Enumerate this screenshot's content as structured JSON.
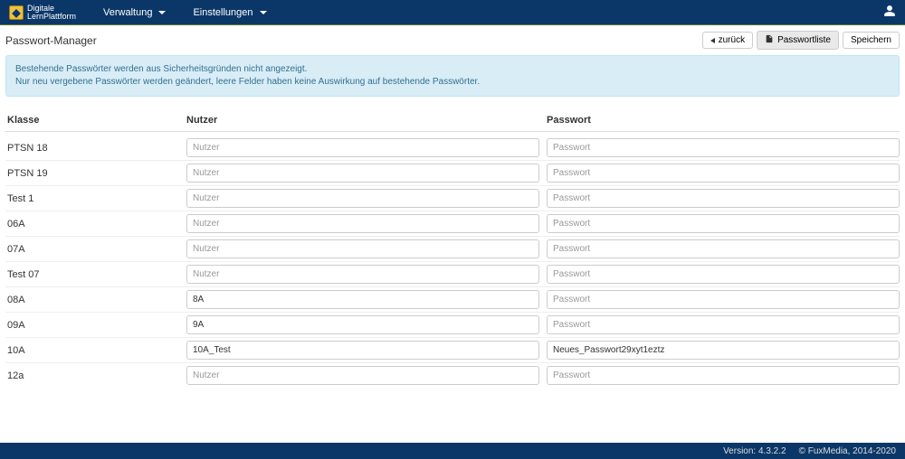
{
  "brand": {
    "line1": "Digitale",
    "line2": "LernPlattform"
  },
  "nav": {
    "verwaltung": "Verwaltung",
    "einstellungen": "Einstellungen"
  },
  "page": {
    "title": "Passwort-Manager",
    "btn_back": "zurück",
    "btn_list": "Passwortliste",
    "btn_save": "Speichern"
  },
  "alert": {
    "line1": "Bestehende Passwörter werden aus Sicherheitsgründen nicht angezeigt.",
    "line2": "Nur neu vergebene Passwörter werden geändert, leere Felder haben keine Auswirkung auf bestehende Passwörter."
  },
  "headers": {
    "klasse": "Klasse",
    "nutzer": "Nutzer",
    "passwort": "Passwort"
  },
  "placeholders": {
    "nutzer": "Nutzer",
    "passwort": "Passwort"
  },
  "rows": [
    {
      "klasse": "PTSN 18",
      "nutzer": "",
      "passwort": ""
    },
    {
      "klasse": "PTSN 19",
      "nutzer": "",
      "passwort": ""
    },
    {
      "klasse": "Test 1",
      "nutzer": "",
      "passwort": ""
    },
    {
      "klasse": "06A",
      "nutzer": "",
      "passwort": ""
    },
    {
      "klasse": "07A",
      "nutzer": "",
      "passwort": ""
    },
    {
      "klasse": "Test 07",
      "nutzer": "",
      "passwort": ""
    },
    {
      "klasse": "08A",
      "nutzer": "8A",
      "passwort": ""
    },
    {
      "klasse": "09A",
      "nutzer": "9A",
      "passwort": ""
    },
    {
      "klasse": "10A",
      "nutzer": "10A_Test",
      "passwort": "Neues_Passwort29xyt1eztz"
    },
    {
      "klasse": "12a",
      "nutzer": "",
      "passwort": ""
    }
  ],
  "footer": {
    "version": "Version: 4.3.2.2",
    "copyright": "© FuxMedia, 2014-2020"
  }
}
